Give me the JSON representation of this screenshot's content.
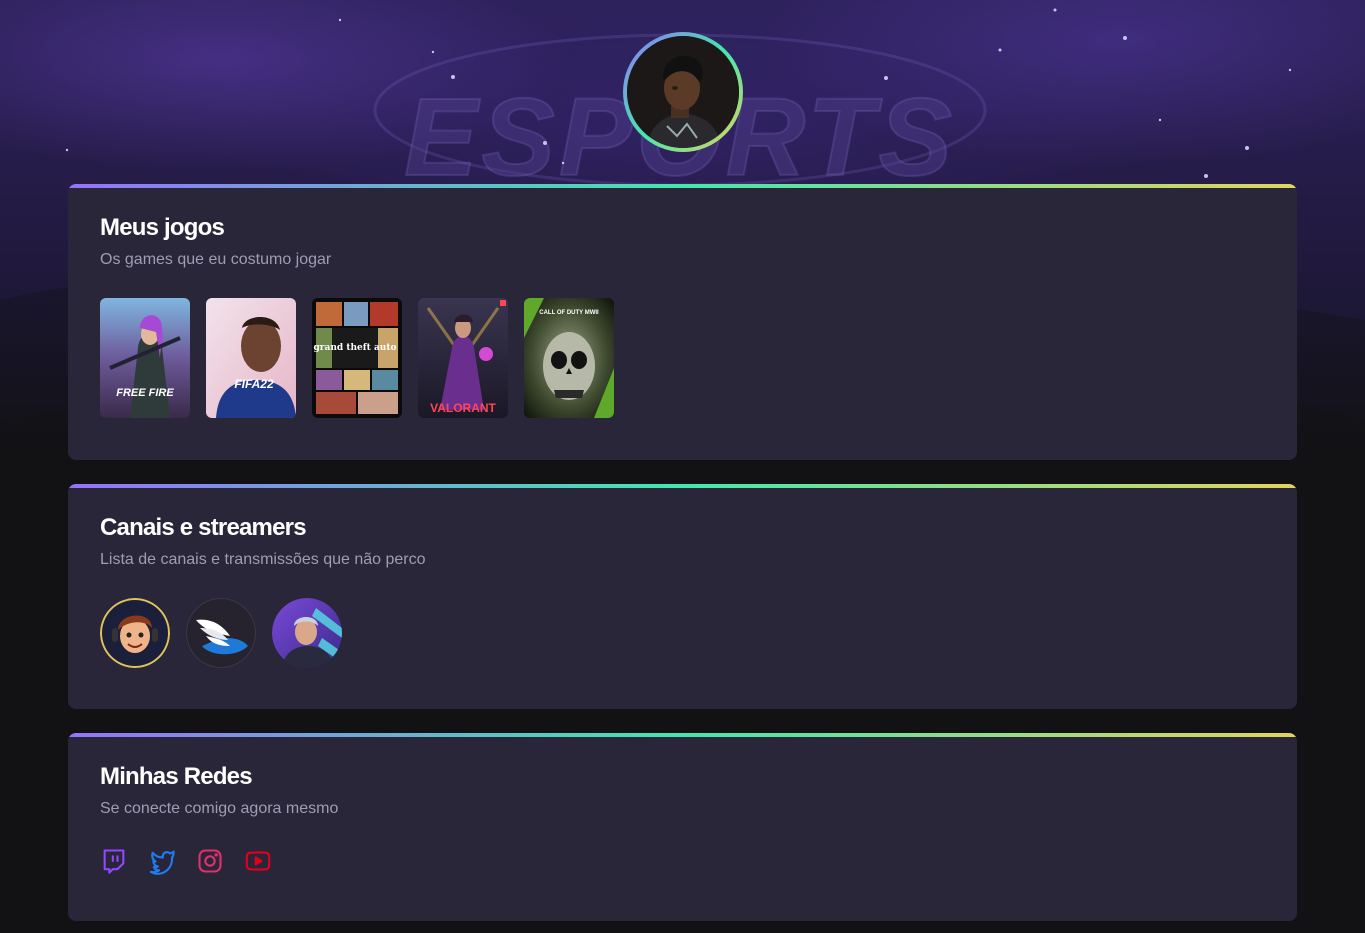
{
  "profile": {
    "avatar_icon": "profile-avatar",
    "gradient": [
      "#9572fc",
      "#43e7ad",
      "#e2d45c"
    ]
  },
  "background": {
    "watermark": "ESPORTS"
  },
  "games_section": {
    "title": "Meus jogos",
    "subtitle": "Os games que eu costumo jogar",
    "games": [
      {
        "name": "Free Fire",
        "cover_text": "FREE FIRE"
      },
      {
        "name": "FIFA 22",
        "cover_text": "FIFA22"
      },
      {
        "name": "Grand Theft Auto V",
        "cover_text": "grand theft auto"
      },
      {
        "name": "Valorant",
        "cover_text": "VALORANT"
      },
      {
        "name": "Call of Duty Modern Warfare II",
        "cover_text": "CALL OF DUTY MWII"
      }
    ]
  },
  "streamers_section": {
    "title": "Canais e streamers",
    "subtitle": "Lista de canais e transmissões que não perco",
    "streamers": [
      {
        "icon": "streamer-avatar-1"
      },
      {
        "icon": "streamer-avatar-2"
      },
      {
        "icon": "streamer-avatar-3"
      }
    ]
  },
  "social_section": {
    "title": "Minhas Redes",
    "subtitle": "Se conecte comigo agora mesmo",
    "links": [
      {
        "name": "twitch",
        "icon": "twitch-icon",
        "color": "#9146ff"
      },
      {
        "name": "twitter",
        "icon": "twitter-icon",
        "color": "#1d7df2"
      },
      {
        "name": "instagram",
        "icon": "instagram-icon",
        "color": "#e1306c"
      },
      {
        "name": "youtube",
        "icon": "youtube-icon",
        "color": "#e3001b"
      }
    ]
  },
  "colors": {
    "page_bg": "#121214",
    "card_bg": "#29263a",
    "title": "#ffffff",
    "subtitle": "#a09cb1"
  }
}
